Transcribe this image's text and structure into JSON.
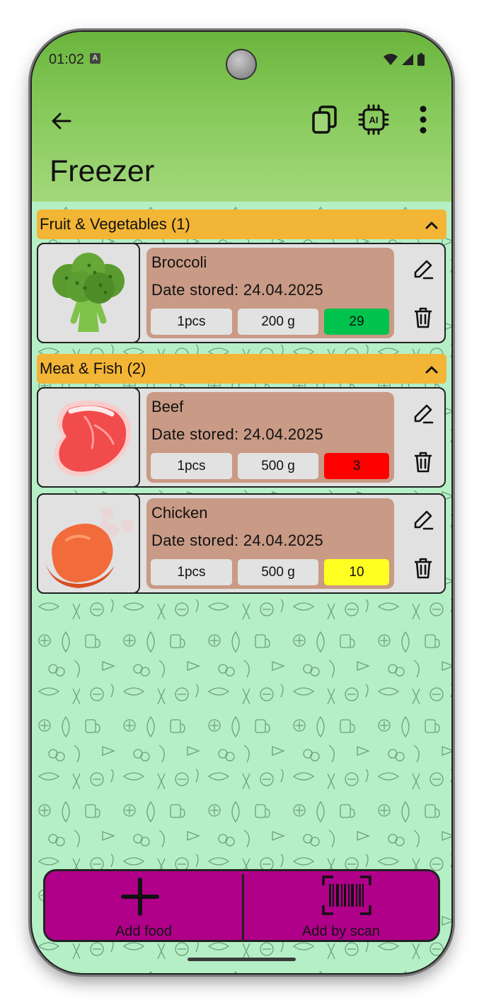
{
  "status_bar": {
    "time": "01:02"
  },
  "app_bar": {
    "title": "Freezer",
    "icons": [
      "arrow-left-icon",
      "copy-icon",
      "ai-chip-icon",
      "more-vertical-icon"
    ]
  },
  "categories": [
    {
      "title": "Fruit & Vegetables (1)",
      "items": [
        {
          "name": "Broccoli",
          "date": "Date stored: 24.04.2025",
          "quantity": "1pcs",
          "weight": "200 g",
          "days": "29",
          "days_color": "#00c34d",
          "image": "broccoli"
        }
      ]
    },
    {
      "title": "Meat & Fish (2)",
      "items": [
        {
          "name": "Beef",
          "date": "Date stored: 24.04.2025",
          "quantity": "1pcs",
          "weight": "500 g",
          "days": "3",
          "days_color": "#ff0000",
          "image": "steak"
        },
        {
          "name": "Chicken",
          "date": "Date stored: 24.04.2025",
          "quantity": "1pcs",
          "weight": "500 g",
          "days": "10",
          "days_color": "#ffff22",
          "image": "chicken"
        }
      ]
    }
  ],
  "bottom_bar": {
    "add_food_label": "Add food",
    "add_scan_label": "Add by scan",
    "color": "#b0008a"
  },
  "colors": {
    "app_bar": "#86c95a",
    "category_header": "#f3b535",
    "card_info": "#c99a85",
    "background": "#b5efc6"
  }
}
